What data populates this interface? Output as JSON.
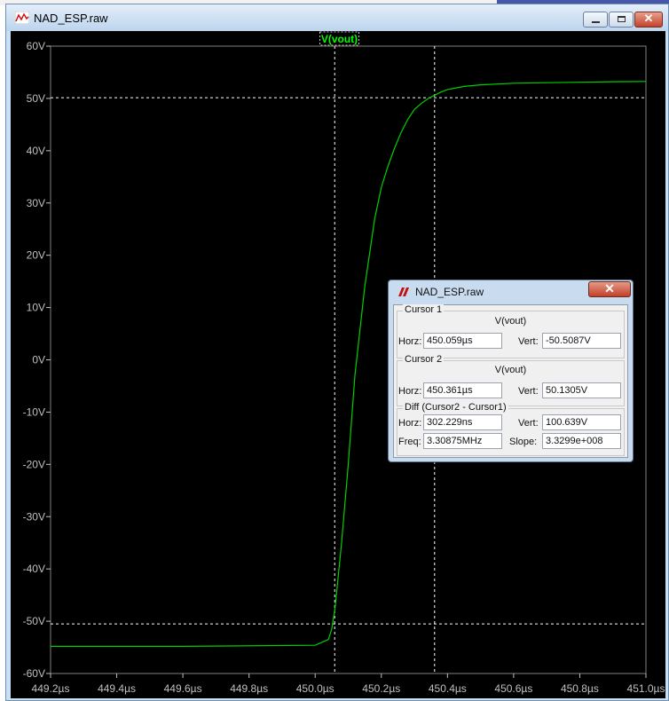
{
  "window": {
    "title": "NAD_ESP.raw",
    "trace_label": "V(vout)"
  },
  "colors": {
    "plot_background": "#000000",
    "trace": "#00d000",
    "grid_line": "#ffffff",
    "tick_label": "#c0c0c0",
    "trace_label": "#00ff00"
  },
  "icons": {
    "app": "waveform-icon",
    "dialog": "ltspice-logo-icon"
  },
  "chart_data": {
    "type": "line",
    "series": [
      {
        "name": "V(vout)",
        "x": [
          449.2,
          449.6,
          450.0,
          450.04,
          450.05,
          450.06,
          450.08,
          450.1,
          450.12,
          450.15,
          450.18,
          450.2,
          450.22,
          450.24,
          450.26,
          450.28,
          450.3,
          450.32,
          450.34,
          450.36,
          450.38,
          450.4,
          450.45,
          450.5,
          450.6,
          450.7,
          450.8,
          450.9,
          451.0
        ],
        "y": [
          -54.8,
          -54.8,
          -54.6,
          -53.5,
          -51.5,
          -47.5,
          -35.0,
          -20.0,
          -3.0,
          14.0,
          27.0,
          33.0,
          37.0,
          40.5,
          43.5,
          46.0,
          47.9,
          49.0,
          49.9,
          50.6,
          51.2,
          51.7,
          52.3,
          52.6,
          52.9,
          53.0,
          53.1,
          53.2,
          53.25
        ]
      }
    ],
    "xlabel": "",
    "ylabel": "",
    "xlim": [
      449.2,
      451.0
    ],
    "ylim": [
      -60,
      60
    ],
    "x_ticks": [
      "449.2µs",
      "449.4µs",
      "449.6µs",
      "449.8µs",
      "450.0µs",
      "450.2µs",
      "450.4µs",
      "450.6µs",
      "450.8µs",
      "451.0µs"
    ],
    "x_tick_values": [
      449.2,
      449.4,
      449.6,
      449.8,
      450.0,
      450.2,
      450.4,
      450.6,
      450.8,
      451.0
    ],
    "y_ticks": [
      "60V",
      "50V",
      "40V",
      "30V",
      "20V",
      "10V",
      "0V",
      "-10V",
      "-20V",
      "-30V",
      "-40V",
      "-50V",
      "-60V"
    ],
    "y_tick_values": [
      60,
      50,
      40,
      30,
      20,
      10,
      0,
      -10,
      -20,
      -30,
      -40,
      -50,
      -60
    ],
    "grid": false,
    "cursors": [
      {
        "x": 450.059,
        "y": -50.5087
      },
      {
        "x": 450.361,
        "y": 50.1305
      }
    ]
  },
  "cursor_dialog": {
    "title": "NAD_ESP.raw",
    "cursor1": {
      "heading": "Cursor 1",
      "trace": "V(vout)",
      "horz_label": "Horz:",
      "horz_value": "450.059µs",
      "vert_label": "Vert:",
      "vert_value": "-50.5087V"
    },
    "cursor2": {
      "heading": "Cursor 2",
      "trace": "V(vout)",
      "horz_label": "Horz:",
      "horz_value": "450.361µs",
      "vert_label": "Vert:",
      "vert_value": "50.1305V"
    },
    "diff": {
      "heading": "Diff (Cursor2 - Cursor1)",
      "horz_label": "Horz:",
      "horz_value": "302.229ns",
      "vert_label": "Vert:",
      "vert_value": "100.639V",
      "freq_label": "Freq:",
      "freq_value": "3.30875MHz",
      "slope_label": "Slope:",
      "slope_value": "3.3299e+008"
    }
  }
}
